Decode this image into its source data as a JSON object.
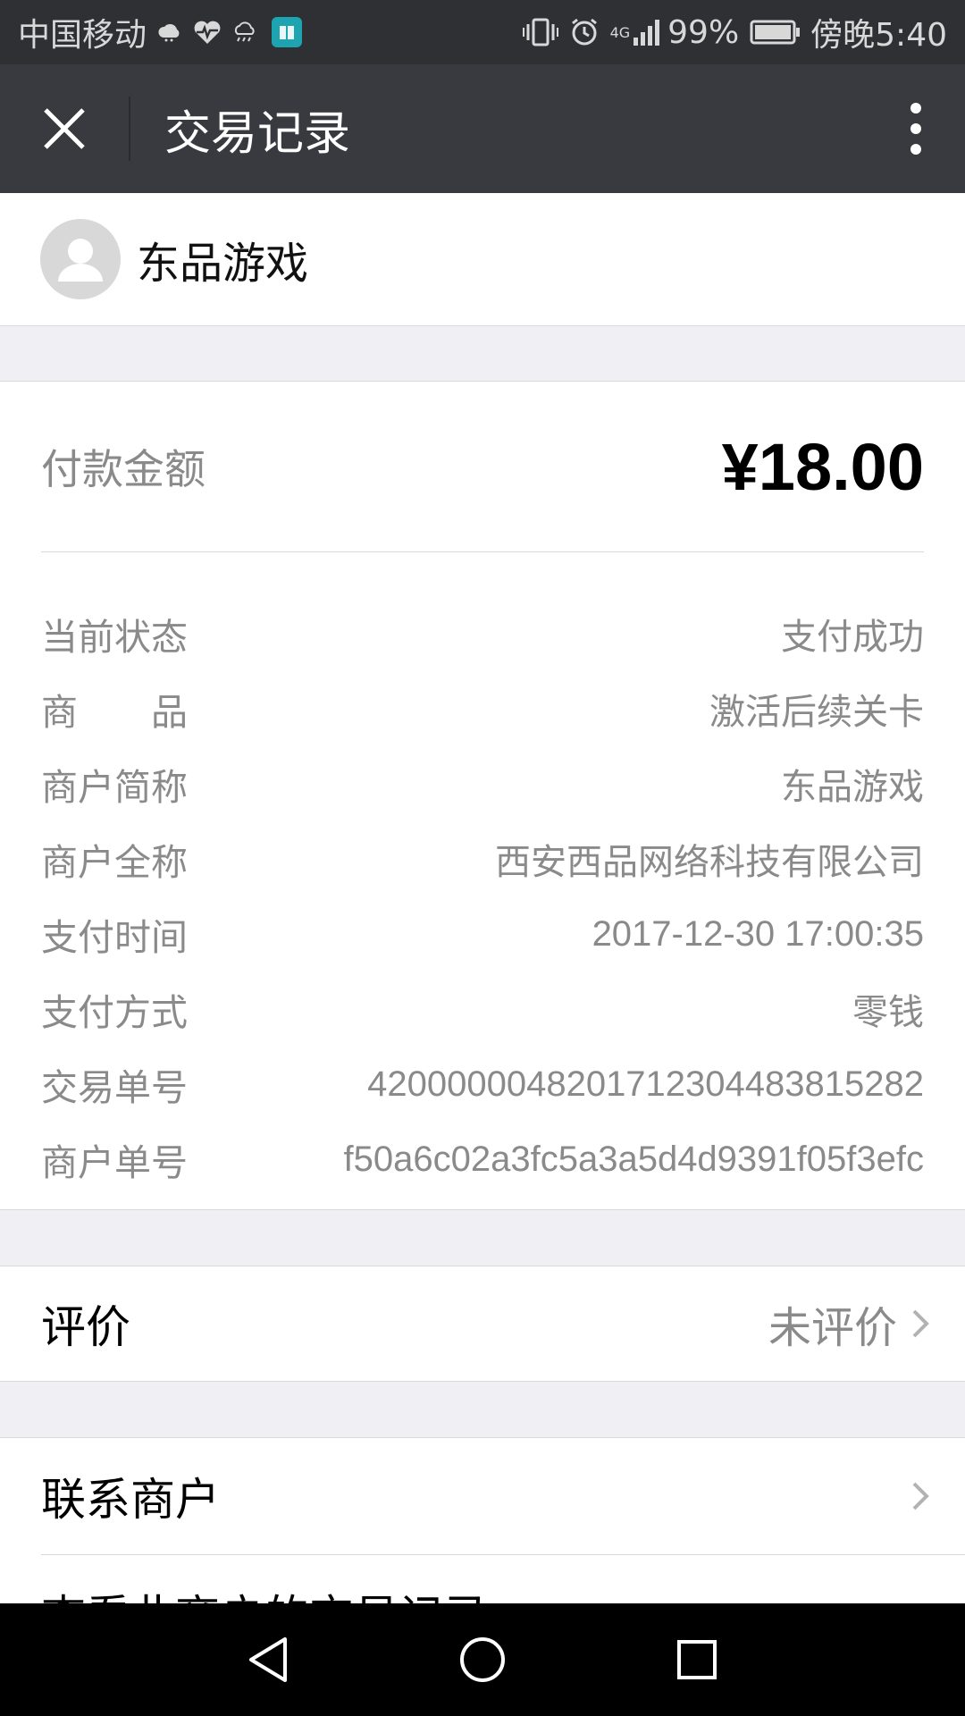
{
  "status_bar": {
    "carrier": "中国移动",
    "battery_percent": "99%",
    "time": "傍晚5:40",
    "network": "4G",
    "icons": [
      "cloud-icon",
      "heart-rate-icon",
      "weather-icon",
      "book-app-icon",
      "vibrate-icon",
      "alarm-icon",
      "signal-icon",
      "battery-icon"
    ]
  },
  "title_bar": {
    "title": "交易记录",
    "close_icon": "close-icon",
    "more_icon": "more-vertical-icon"
  },
  "merchant": {
    "name": "东品游戏",
    "avatar_icon": "default-avatar-icon"
  },
  "payment": {
    "amount_label": "付款金额",
    "amount_value": "¥18.00"
  },
  "details": [
    {
      "label": "当前状态",
      "value": "支付成功"
    },
    {
      "label": "商　　品",
      "value": "激活后续关卡"
    },
    {
      "label": "商户简称",
      "value": "东品游戏"
    },
    {
      "label": "商户全称",
      "value": "西安西品网络科技有限公司"
    },
    {
      "label": "支付时间",
      "value": "2017-12-30 17:00:35"
    },
    {
      "label": "支付方式",
      "value": "零钱"
    },
    {
      "label": "交易单号",
      "value": "4200000048201712304483815282"
    },
    {
      "label": "商户单号",
      "value": "f50a6c02a3fc5a3a5d4d9391f05f3efc"
    }
  ],
  "review": {
    "label": "评价",
    "status": "未评价"
  },
  "actions": {
    "contact_label": "联系商户",
    "history_label": "查看此商户的交易记录"
  },
  "nav_bar": {
    "icons": [
      "back-icon",
      "home-icon",
      "recents-icon"
    ]
  },
  "colors": {
    "status_bar_bg": "#2f3034",
    "title_bar_bg": "#393a3f",
    "page_bg": "#efeff4",
    "secondary_text": "#8a8a8a"
  }
}
